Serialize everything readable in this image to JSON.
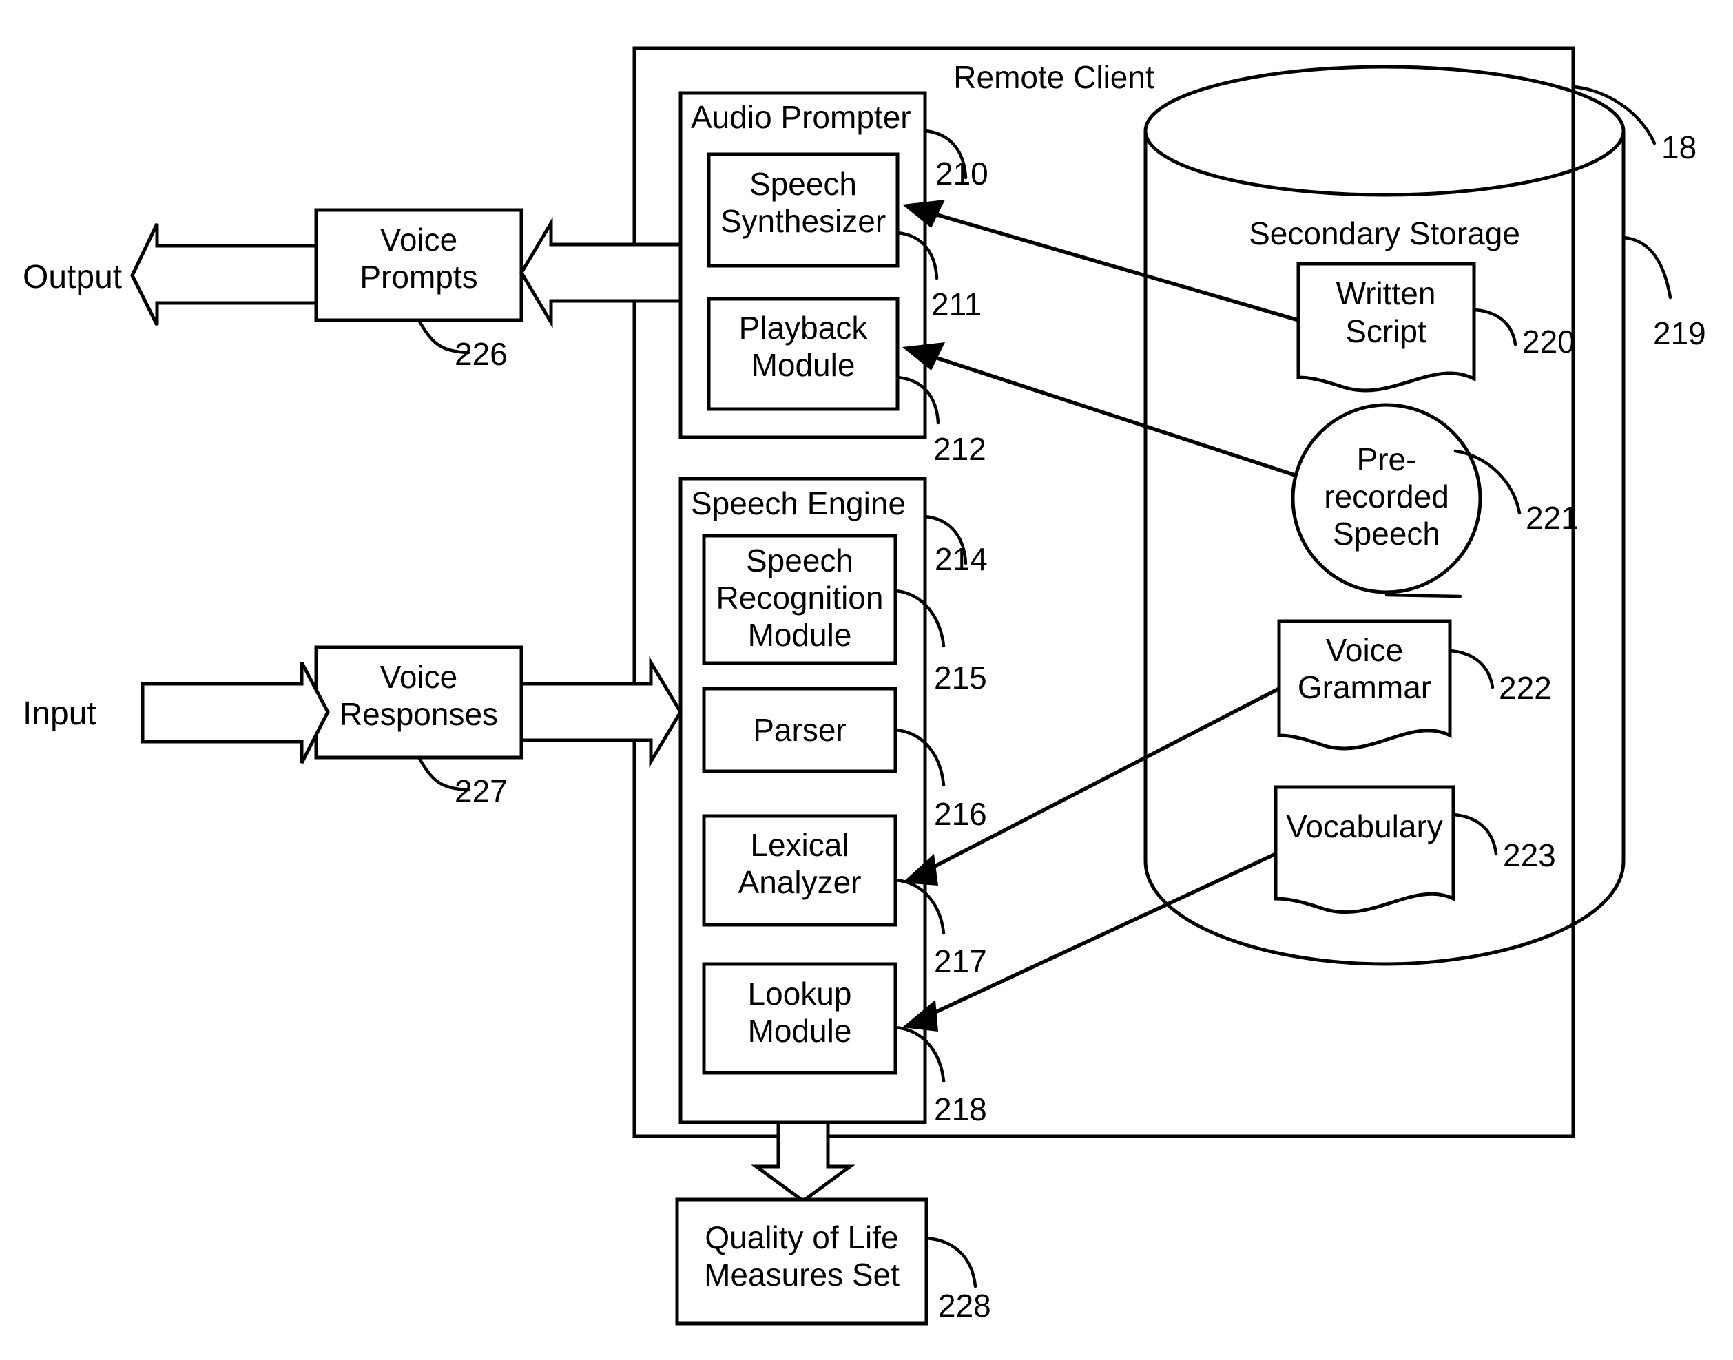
{
  "figure": {
    "title": "Remote Client voice interaction block diagram",
    "outer_container_label": "Remote Client",
    "outer_container_ref": "18"
  },
  "external": {
    "output_label": "Output",
    "input_label": "Input"
  },
  "io_blocks": [
    {
      "id": "voice-prompts",
      "label_line1": "Voice",
      "label_line2": "Prompts",
      "ref": "226"
    },
    {
      "id": "voice-responses",
      "label_line1": "Voice",
      "label_line2": "Responses",
      "ref": "227"
    }
  ],
  "audio_prompter": {
    "title": "Audio Prompter",
    "ref": "210",
    "modules": [
      {
        "id": "speech-synthesizer",
        "line1": "Speech",
        "line2": "Synthesizer",
        "ref": "211"
      },
      {
        "id": "playback-module",
        "line1": "Playback",
        "line2": "Module",
        "ref": "212"
      }
    ]
  },
  "speech_engine": {
    "title": "Speech Engine",
    "ref": "214",
    "modules": [
      {
        "id": "speech-recognition-module",
        "line1": "Speech",
        "line2": "Recognition",
        "line3": "Module",
        "ref": "215"
      },
      {
        "id": "parser",
        "line1": "Parser",
        "line2": "",
        "line3": "",
        "ref": "216"
      },
      {
        "id": "lexical-analyzer",
        "line1": "Lexical",
        "line2": "Analyzer",
        "line3": "",
        "ref": "217"
      },
      {
        "id": "lookup-module",
        "line1": "Lookup",
        "line2": "Module",
        "line3": "",
        "ref": "218"
      }
    ]
  },
  "secondary_storage": {
    "title": "Secondary Storage",
    "ref": "219",
    "items": [
      {
        "id": "written-script",
        "shape": "document",
        "line1": "Written",
        "line2": "Script",
        "ref": "220"
      },
      {
        "id": "pre-recorded-speech",
        "shape": "circle",
        "line1": "Pre-",
        "line2": "recorded",
        "line3": "Speech",
        "ref": "221"
      },
      {
        "id": "voice-grammar",
        "shape": "document",
        "line1": "Voice",
        "line2": "Grammar",
        "ref": "222"
      },
      {
        "id": "vocabulary",
        "shape": "document",
        "line1": "Vocabulary",
        "line2": "",
        "ref": "223"
      }
    ]
  },
  "output_block": {
    "id": "quality-of-life-measures-set",
    "line1": "Quality of Life",
    "line2": "Measures Set",
    "ref": "228"
  },
  "colors": {
    "stroke": "#000000",
    "background": "#ffffff"
  }
}
